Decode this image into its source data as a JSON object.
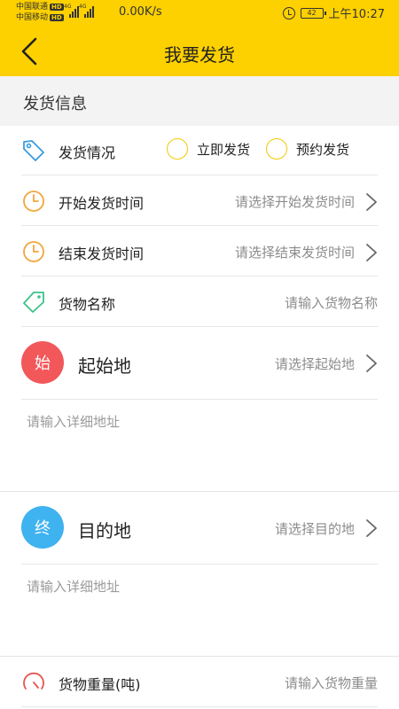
{
  "status_bar": {
    "carrier1": "中国联通",
    "carrier2": "中国移动",
    "hd": "HD",
    "network": "4G",
    "speed": "0.00K/s",
    "battery": "42",
    "time": "上午10:27",
    "alarm_icon": "alarm-clock-icon"
  },
  "header": {
    "title": "我要发货",
    "back_icon": "chevron-left-icon",
    "background": "#fdd000"
  },
  "section": {
    "title": "发货信息"
  },
  "form": {
    "shipping_status": {
      "label": "发货情况",
      "icon": "tag-icon",
      "options": [
        "立即发货",
        "预约发货"
      ]
    },
    "start_time": {
      "label": "开始发货时间",
      "placeholder": "请选择开始发货时间",
      "icon": "clock-icon"
    },
    "end_time": {
      "label": "结束发货时间",
      "placeholder": "请选择结束发货时间",
      "icon": "clock-icon"
    },
    "goods_name": {
      "label": "货物名称",
      "placeholder": "请输入货物名称",
      "icon": "price-tag-icon"
    },
    "origin": {
      "badge": "始",
      "badge_color": "#f2575a",
      "label": "起始地",
      "placeholder": "请选择起始地",
      "address_placeholder": "请输入详细地址"
    },
    "destination": {
      "badge": "终",
      "badge_color": "#3fb2f0",
      "label": "目的地",
      "placeholder": "请选择目的地",
      "address_placeholder": "请输入详细地址"
    },
    "weight": {
      "label": "货物重量(吨)",
      "placeholder": "请输入货物重量",
      "icon": "gauge-icon"
    }
  }
}
